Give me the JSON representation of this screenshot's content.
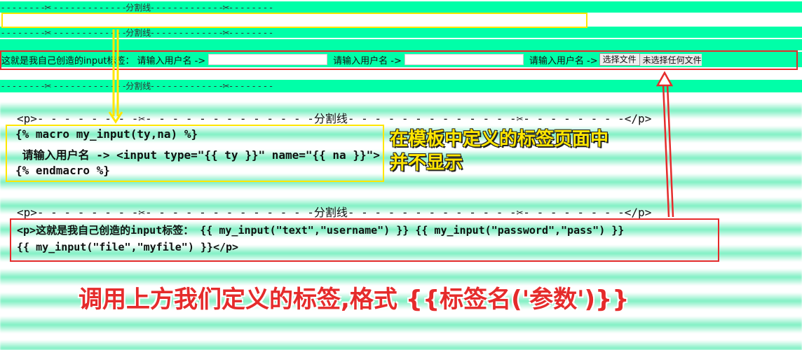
{
  "rendered": {
    "separator": "- - - - - - - -✂ - - - - - - - - - - - - -分割线- - - - - - - - - - - - -✂- - - - - - - -",
    "form": {
      "intro": "这就是我自己创造的input标签：",
      "prompt": "请输入用户名 ->",
      "file_button": "选择文件",
      "file_status": "未选择任何文件"
    }
  },
  "code": {
    "p_separator": "<p>- - - - - - - -✂- - - - - - - - - - - - -分割线- - - - - - - - - - - - -✂- - - - - - - -</p>",
    "macro_line1": "{% macro my_input(ty,na) %}",
    "macro_line2": " 请输入用户名 -> <input type=\"{{ ty }}\" name=\"{{ na }}\">",
    "macro_line3": "{% endmacro %}",
    "call_line1": "<p>这就是我自己创造的input标签： {{ my_input(\"text\",\"username\") }} {{ my_input(\"password\",\"pass\") }}",
    "call_line2": "{{ my_input(\"file\",\"myfile\") }}</p>"
  },
  "notes": {
    "yellow_line1": "在模板中定义的标签页面中",
    "yellow_line2": "并不显示",
    "red": "调用上方我们定义的标签,格式 {{标签名('参数')}}"
  },
  "colors": {
    "green": "#00ffa8",
    "yellow": "#ffe600",
    "red": "#e52b2b"
  }
}
